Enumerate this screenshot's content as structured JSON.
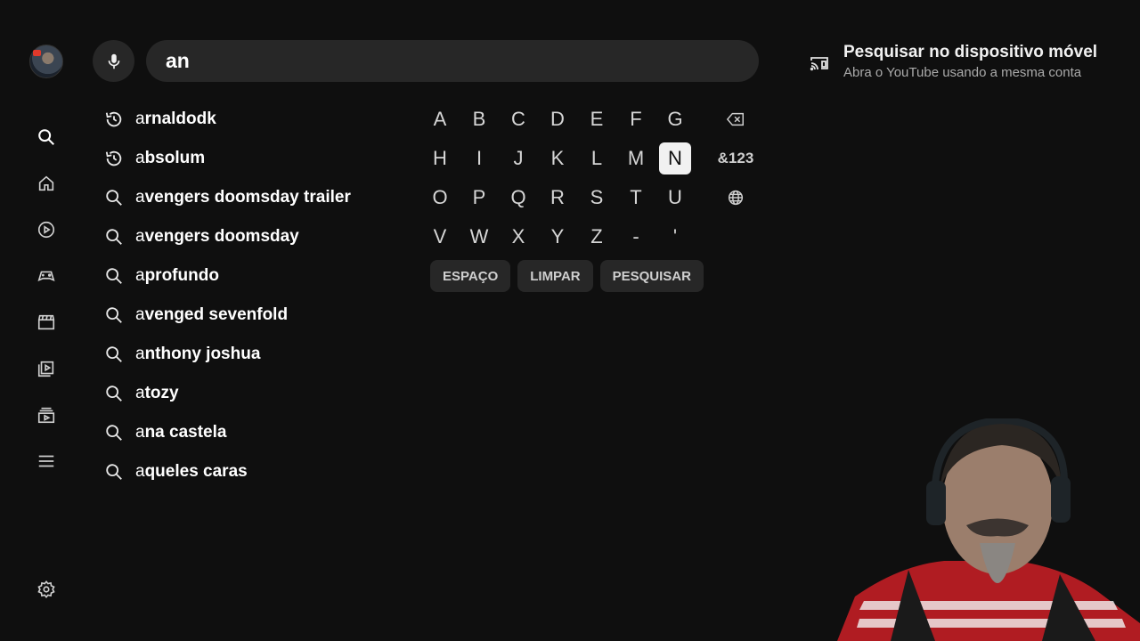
{
  "user": {
    "avatar_icon": "user-avatar"
  },
  "sidebar": {
    "items": [
      {
        "name": "search",
        "icon": "search-icon",
        "active": true
      },
      {
        "name": "home",
        "icon": "home-icon"
      },
      {
        "name": "shorts",
        "icon": "play-circle-icon"
      },
      {
        "name": "gaming",
        "icon": "gamepad-icon"
      },
      {
        "name": "movies",
        "icon": "clapperboard-icon"
      },
      {
        "name": "playlists",
        "icon": "playlist-icon"
      },
      {
        "name": "subscriptions",
        "icon": "subscriptions-icon"
      },
      {
        "name": "menu",
        "icon": "menu-icon"
      }
    ],
    "settings_icon": "gear-icon"
  },
  "search": {
    "mic_icon": "microphone-icon",
    "query": "an"
  },
  "suggestions": [
    {
      "type": "history",
      "prefix": "a",
      "rest": "rnaldodk"
    },
    {
      "type": "history",
      "prefix": "a",
      "rest": "bsolum"
    },
    {
      "type": "search",
      "prefix": "a",
      "rest": "vengers doomsday trailer"
    },
    {
      "type": "search",
      "prefix": "a",
      "rest": "vengers doomsday"
    },
    {
      "type": "search",
      "prefix": "a",
      "rest": "profundo"
    },
    {
      "type": "search",
      "prefix": "a",
      "rest": "venged sevenfold"
    },
    {
      "type": "search",
      "prefix": "a",
      "rest": "nthony joshua"
    },
    {
      "type": "search",
      "prefix": "a",
      "rest": "tozy"
    },
    {
      "type": "search",
      "prefix": "a",
      "rest": "na castela"
    },
    {
      "type": "search",
      "prefix": "a",
      "rest": "queles caras"
    }
  ],
  "keyboard": {
    "rows": [
      [
        "A",
        "B",
        "C",
        "D",
        "E",
        "F",
        "G"
      ],
      [
        "H",
        "I",
        "J",
        "K",
        "L",
        "M",
        "N"
      ],
      [
        "O",
        "P",
        "Q",
        "R",
        "S",
        "T",
        "U"
      ],
      [
        "V",
        "W",
        "X",
        "Y",
        "Z",
        "-",
        "'"
      ]
    ],
    "selected_key": "N",
    "special": [
      "backspace-icon",
      "&123",
      "globe-icon"
    ],
    "actions": [
      "ESPAÇO",
      "LIMPAR",
      "PESQUISAR"
    ]
  },
  "cast_panel": {
    "icon": "cast-icon",
    "title": "Pesquisar no dispositivo móvel",
    "subtitle": "Abra o YouTube usando a mesma conta"
  }
}
